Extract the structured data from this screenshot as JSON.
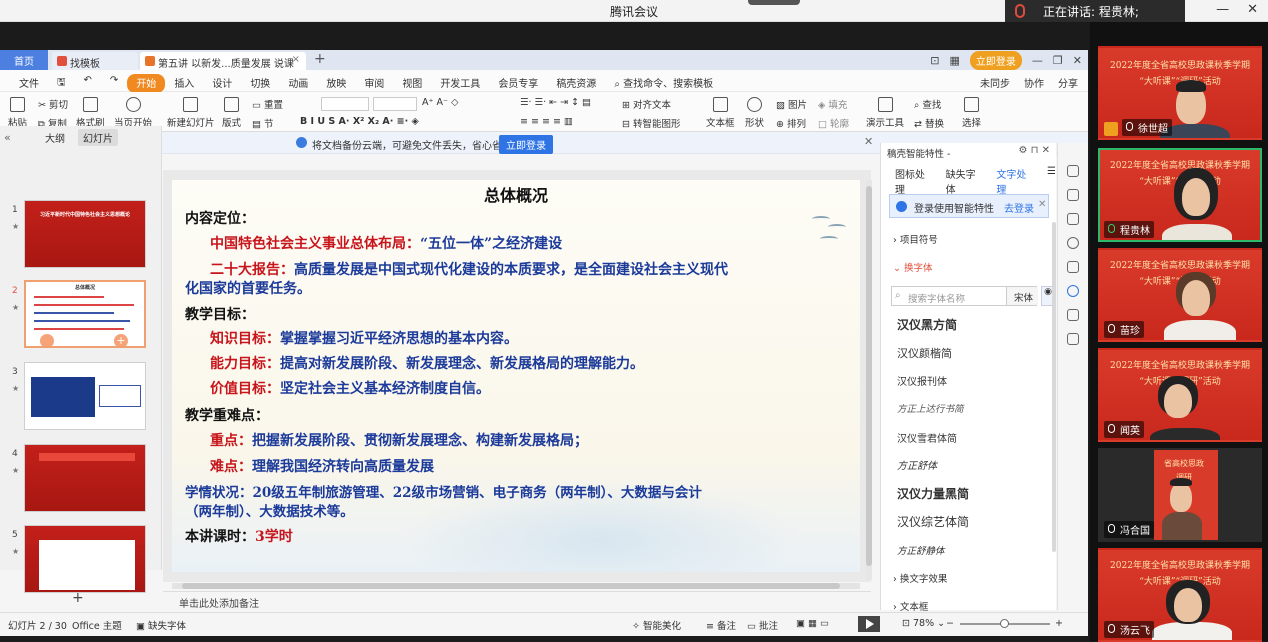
{
  "meeting": {
    "app_title": "腾讯会议",
    "speaking": "正在讲话: 程贵林;"
  },
  "wps": {
    "tabs": [
      {
        "label": "首页"
      },
      {
        "label": "找模板"
      },
      {
        "label": "第五讲 以新发...质量发展 说课"
      }
    ],
    "login_button": "立即登录",
    "menu": {
      "file": "文件",
      "items": [
        "开始",
        "插入",
        "设计",
        "切换",
        "动画",
        "放映",
        "审阅",
        "视图",
        "开发工具",
        "会员专享",
        "稿壳资源"
      ],
      "search": "查找命令、搜索模板",
      "sync": "未同步",
      "collab": "协作",
      "share": "分享"
    },
    "ribbon": {
      "paste": "粘贴",
      "cut": "剪切",
      "copy": "复制",
      "format_painter": "格式刷",
      "from_current": "当页开始",
      "new_slide": "新建幻灯片",
      "layout": "版式",
      "section": "节",
      "reset": "重置",
      "align_text": "对齐文本",
      "convert_smartart": "转智能图形",
      "textbox": "文本框",
      "shape": "形状",
      "arrange": "排列",
      "picture": "图片",
      "fill": "填充",
      "outline": "轮廓",
      "presenter_tools": "演示工具",
      "find": "查找",
      "replace": "替换",
      "select": "选择"
    },
    "notification": {
      "text": "将文档备份云端，可避免文件丢失，省心省事",
      "button": "立即登录"
    },
    "left_panel": {
      "tab_outline": "大纲",
      "tab_slides": "幻灯片",
      "slides": [
        {
          "num": "1",
          "title": "习近平新时代中国特色社会主义思想概论"
        },
        {
          "num": "2",
          "title": "总体概况"
        },
        {
          "num": "3",
          "title": ""
        },
        {
          "num": "4",
          "title": ""
        },
        {
          "num": "5",
          "title": ""
        }
      ]
    },
    "slide": {
      "title": "总体概况",
      "s1": "内容定位：",
      "s1a_label": "中国特色社会主义事业总体布局：",
      "s1a_text": "“五位一体”之经济建设",
      "s1b_label": "二十大报告：",
      "s1b_text": "高质量发展是中国式现代化建设的本质要求，是全面建设社会主义现代",
      "s1b_text2": "化国家的首要任务。",
      "s2": "教学目标：",
      "s2a_label": "知识目标：",
      "s2a_text": "掌握掌握习近平经济思想的基本内容。",
      "s2b_label": "能力目标：",
      "s2b_text": "提高对新发展阶段、新发展理念、新发展格局的理解能力。",
      "s2c_label": "价值目标：",
      "s2c_text": "坚定社会主义基本经济制度自信。",
      "s3": "教学重难点：",
      "s3a_label": "重点：",
      "s3a_text": "把握新发展阶段、贯彻新发展理念、构建新发展格局；",
      "s3b_label": "难点：",
      "s3b_text": "理解我国经济转向高质量发展",
      "s4": "学情状况：20级五年制旅游管理、22级市场营销、电子商务（两年制）、大数据与会计",
      "s4b": "（两年制）、大数据技术等。",
      "s5_label": "本讲课时：",
      "s5_value": "3学时"
    },
    "notes_placeholder": "单击此处添加备注",
    "right_panel": {
      "header": "稿壳智能特性 -",
      "tabs": [
        "图标处理",
        "缺失字体",
        "文字处理"
      ],
      "login_tip": "登录使用智能特性",
      "login_link": "去登录",
      "section_bullets": "项目符号",
      "section_replace_font": "换字体",
      "search_placeholder": "搜索字体名称",
      "search_scope": "宋体",
      "fonts": [
        "汉仪黑方简",
        "汉仪颜楷简",
        "汉仪报刊体",
        "方正上达行书简",
        "汉仪雪君体简",
        "方正舒体",
        "汉仪力量黑简",
        "汉仪综艺体简",
        "方正舒静体"
      ],
      "section_text_effect": "换文字效果",
      "section_textbox": "文本框"
    },
    "status": {
      "slide_count": "幻灯片 2 / 30",
      "theme": "Office 主题",
      "missing_font": "缺失字体",
      "smart_beautify": "智能美化",
      "notes": "备注",
      "comments": "批注",
      "zoom": "78%"
    }
  },
  "participants": [
    {
      "name": "徐世超",
      "banner1": "2022年度全省高校思政课秋季学期",
      "banner2": "“大听课”“调研”活动"
    },
    {
      "name": "程贵林",
      "banner1": "2022年度全省高校思政课秋季学期",
      "banner2": "“大听课”“调研”活动"
    },
    {
      "name": "苗珍",
      "banner1": "2022年度全省高校思政课秋季学期",
      "banner2": "“大听课”“调研”活动"
    },
    {
      "name": "闻英",
      "banner1": "2022年度全省高校思政课秋季学期",
      "banner2": "“大听课”“调研”活动"
    },
    {
      "name": "冯合国",
      "banner1": "省高校思政",
      "banner2": "调研"
    },
    {
      "name": "汤云飞",
      "banner1": "2022年度全省高校思政课秋季学期",
      "banner2": "“大听课”“调研”活动"
    }
  ]
}
